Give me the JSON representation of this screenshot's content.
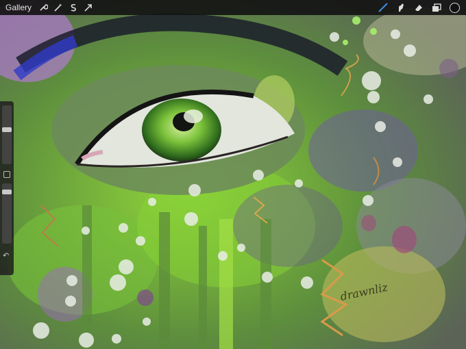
{
  "app": {
    "gallery_label": "Gallery"
  },
  "toolbar": {
    "left_icons": [
      "wrench-icon",
      "magic-wand-icon",
      "selection-s-icon",
      "transform-arrow-icon"
    ],
    "right_icons": [
      "brush-icon",
      "smudge-icon",
      "eraser-icon",
      "layers-icon"
    ],
    "active_tool": "brush",
    "active_color": "#111111",
    "accent": "#3c8fe6"
  },
  "sidebar": {
    "brush_size_level": 0.35,
    "opacity_level": 0.18,
    "modify_icon": "square-icon",
    "undo_icon": "undo-arrow-icon"
  },
  "artwork": {
    "signature": "drawnliz"
  }
}
